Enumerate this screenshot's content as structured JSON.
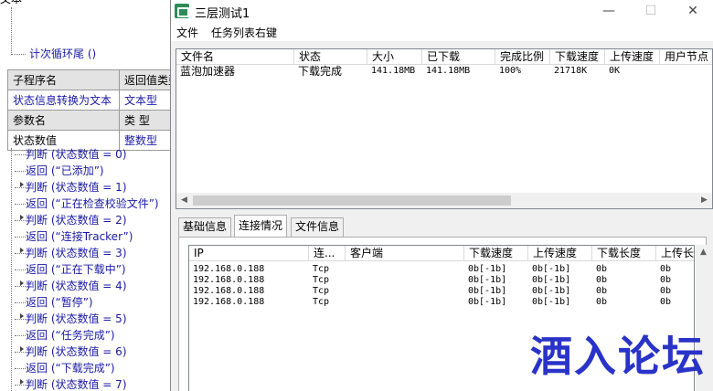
{
  "editor": {
    "top_partial": "文本",
    "counter_loop": "计次循环尾 ()",
    "sub_table": {
      "header_row_1": [
        "子程序名",
        "返回值类型"
      ],
      "value_row_1": [
        "状态信息转换为文本",
        "文本型"
      ],
      "header_row_2": [
        "参数名",
        "类 型"
      ],
      "value_row_2": [
        "状态数值",
        "整数型"
      ]
    },
    "code_lines": [
      {
        "kind": "judge",
        "text": "判断 (状态数值 = 0)"
      },
      {
        "kind": "return",
        "text": "返回 (“已添加”)"
      },
      {
        "kind": "judge",
        "text": "判断 (状态数值 = 1)"
      },
      {
        "kind": "return",
        "text": "返回 (“正在检查校验文件”)"
      },
      {
        "kind": "judge",
        "text": "判断 (状态数值 = 2)"
      },
      {
        "kind": "return",
        "text": "返回 (“连接Tracker”)"
      },
      {
        "kind": "judge",
        "text": "判断 (状态数值 = 3)"
      },
      {
        "kind": "return",
        "text": "返回 (“正在下载中”)"
      },
      {
        "kind": "judge",
        "text": "判断 (状态数值 = 4)"
      },
      {
        "kind": "return",
        "text": "返回 (“暂停”)"
      },
      {
        "kind": "judge",
        "text": "判断 (状态数值 = 5)"
      },
      {
        "kind": "return",
        "text": "返回 (“任务完成”)"
      },
      {
        "kind": "judge",
        "text": "判断 (状态数值 = 6)"
      },
      {
        "kind": "return",
        "text": "返回 (“下载完成”)"
      },
      {
        "kind": "judge",
        "text": "判断 (状态数值 = 7)"
      }
    ]
  },
  "window": {
    "title": "三层测试1",
    "controls": {
      "minimize": "—",
      "maximize": "☐",
      "close": "✕"
    },
    "menu": [
      "文件",
      "任务列表右键"
    ],
    "task_list": {
      "columns": [
        "文件名",
        "状态",
        "大小",
        "已下载",
        "完成比例",
        "下载速度",
        "上传速度",
        "用户节点"
      ],
      "rows": [
        [
          "蓝泡加速器",
          "下载完成",
          "141.18MB",
          "141.18MB",
          "100%",
          "21718K",
          "0K",
          ""
        ]
      ]
    },
    "tabs": [
      "基础信息",
      "连接情况",
      "文件信息"
    ],
    "active_tab": "连接情况",
    "connections": {
      "columns": [
        "IP",
        "连...",
        "客户端",
        "下载速度",
        "上传速度",
        "下载长度",
        "上传长"
      ],
      "rows": [
        [
          "192.168.0.188",
          "Tcp",
          "",
          "0b[-1b]",
          "0b[-1b]",
          "0b",
          "0b"
        ],
        [
          "192.168.0.188",
          "Tcp",
          "",
          "0b[-1b]",
          "0b[-1b]",
          "0b",
          "0b"
        ],
        [
          "192.168.0.188",
          "Tcp",
          "",
          "0b[-1b]",
          "0b[-1b]",
          "0b",
          "0b"
        ],
        [
          "192.168.0.188",
          "Tcp",
          "",
          "0b[-1b]",
          "0b[-1b]",
          "0b",
          "0b"
        ]
      ]
    }
  },
  "watermark": "酒入论坛",
  "colors": {
    "keyword": "#1a1aa6",
    "string": "#0a7a7a",
    "watermark": "#2a33c8",
    "app_icon": "#2e8b57"
  }
}
